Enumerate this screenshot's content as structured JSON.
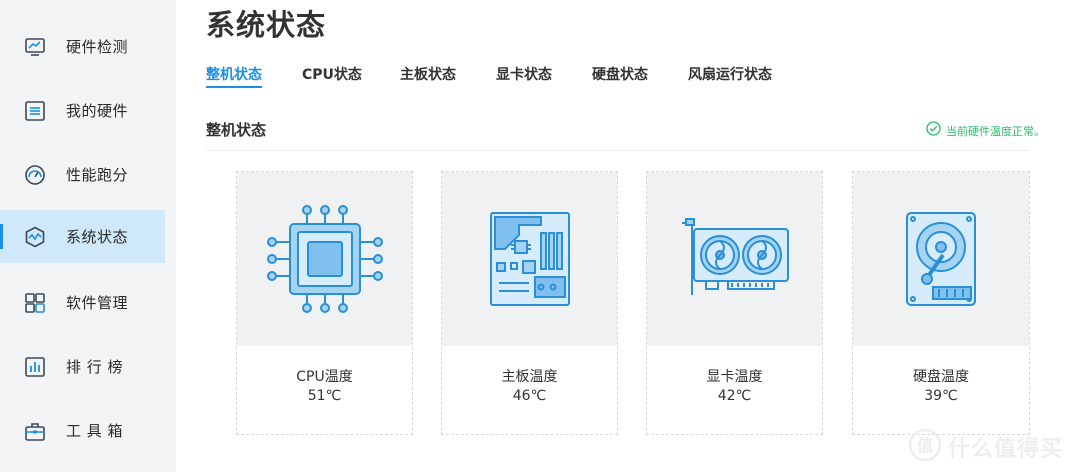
{
  "sidebar": {
    "items": [
      {
        "label": "硬件检测",
        "icon": "monitor-chart-icon",
        "active": false
      },
      {
        "label": "我的硬件",
        "icon": "hardware-list-icon",
        "active": false
      },
      {
        "label": "性能跑分",
        "icon": "speed-gauge-icon",
        "active": false
      },
      {
        "label": "系统状态",
        "icon": "hexagon-wave-icon",
        "active": true
      },
      {
        "label": "软件管理",
        "icon": "apps-grid-icon",
        "active": false
      },
      {
        "label": "排 行 榜",
        "icon": "bar-chart-icon",
        "active": false
      },
      {
        "label": "工 具 箱",
        "icon": "toolbox-icon",
        "active": false
      }
    ]
  },
  "header": {
    "title": "系统状态"
  },
  "tabs": [
    {
      "label": "整机状态",
      "active": true
    },
    {
      "label": "CPU状态",
      "active": false
    },
    {
      "label": "主板状态",
      "active": false
    },
    {
      "label": "显卡状态",
      "active": false
    },
    {
      "label": "硬盘状态",
      "active": false
    },
    {
      "label": "风扇运行状态",
      "active": false
    }
  ],
  "section": {
    "title": "整机状态",
    "status_text": "当前硬件温度正常。"
  },
  "cards": [
    {
      "name": "CPU温度",
      "value": "51℃",
      "icon": "cpu-chip-icon"
    },
    {
      "name": "主板温度",
      "value": "46℃",
      "icon": "motherboard-icon"
    },
    {
      "name": "显卡温度",
      "value": "42℃",
      "icon": "graphics-card-icon"
    },
    {
      "name": "硬盘温度",
      "value": "39℃",
      "icon": "hard-disk-icon"
    }
  ],
  "watermark": {
    "text": "什么值得买",
    "badge": "值"
  },
  "colors": {
    "accent": "#1a8fe3",
    "sidebar_bg": "#f3f4f6",
    "active_bg": "#cfe9fb",
    "status_ok": "#2fb86a",
    "icon_fill": "#a5d4f3",
    "icon_stroke": "#2a8fd6"
  }
}
